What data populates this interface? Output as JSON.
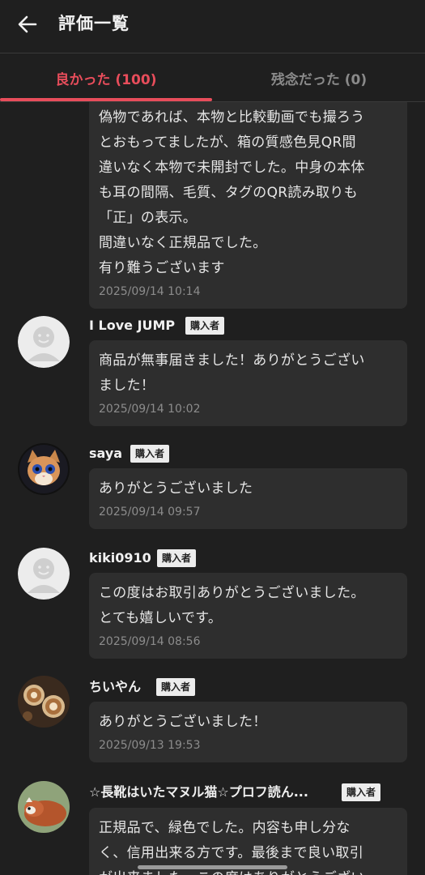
{
  "header": {
    "title": "評価一覧",
    "back_icon": "arrow-left-icon"
  },
  "tabs": [
    {
      "label": "良かった (100)",
      "active": true
    },
    {
      "label": "残念だった (0)",
      "active": false
    }
  ],
  "colors": {
    "accent": "#e84d5b",
    "background": "#1f1f1f",
    "bubble": "#2e2e2e"
  },
  "reviews": [
    {
      "message": "偽物であれば、本物と比較動画でも撮ろう\nとおもってましたが、箱の質感色見QR間\n違いなく本物で未開封でした。中身の本体\nも耳の間隔、毛質、タグのQR読み取りも\n「正」の表示。\n間違いなく正規品でした。\n有り難うございます",
      "timestamp": "2025/09/14 10:14"
    },
    {
      "name": "I Love JUMP",
      "badge": "購入者",
      "avatar": "default-avatar-icon",
      "message": "商品が無事届きました！ありがとうござい\nました！",
      "timestamp": "2025/09/14 10:02"
    },
    {
      "name": "saya",
      "badge": "購入者",
      "avatar": "kitten-photo",
      "message": "ありがとうございました",
      "timestamp": "2025/09/14 09:57"
    },
    {
      "name": "kiki0910",
      "badge": "購入者",
      "avatar": "default-avatar-icon",
      "message": "この度はお取引ありがとうございました。\nとても嬉しいです。",
      "timestamp": "2025/09/14 08:56"
    },
    {
      "name": "ちいやん",
      "badge": "購入者",
      "avatar": "latte-art-photo",
      "message": "ありがとうございました！",
      "timestamp": "2025/09/13 19:53"
    },
    {
      "name": "☆長靴はいたマヌル猫☆プロフ読ん...",
      "badge": "購入者",
      "avatar": "red-panda-photo",
      "message": "正規品で、緑色でした。内容も申し分な\nく、信用出来る方です。最後まで良い取引\nが出来ました。この度はありがとうござい",
      "timestamp": ""
    }
  ]
}
